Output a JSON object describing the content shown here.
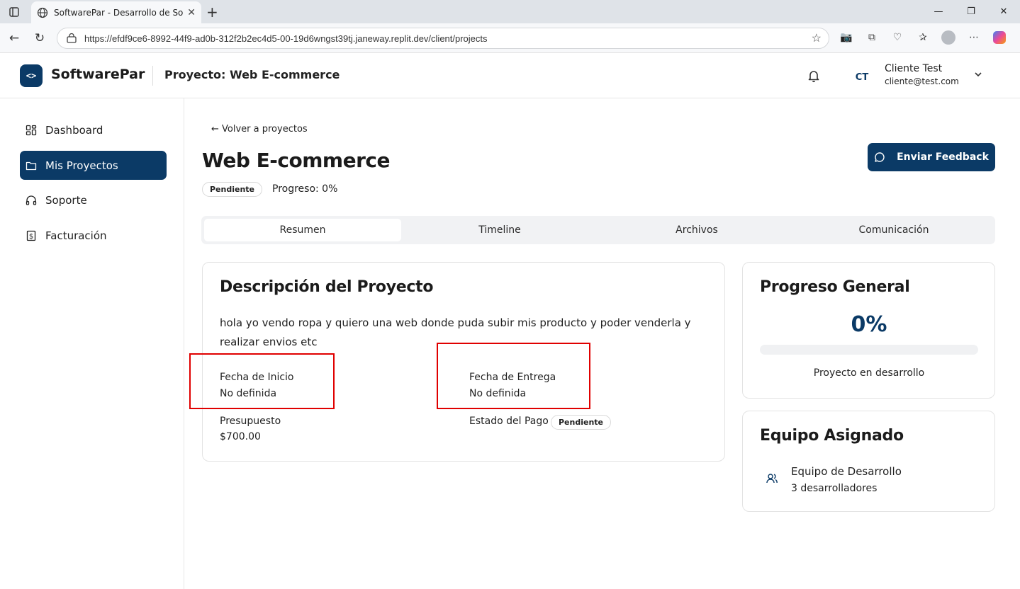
{
  "browser": {
    "tab_title": "SoftwarePar - Desarrollo de Softw",
    "url": "https://efdf9ce6-8992-44f9-ad0b-312f2b2ec4d5-00-19d6wngst39tj.janeway.replit.dev/client/projects"
  },
  "header": {
    "logo_glyph": "<>",
    "brand": "SoftwarePar",
    "project_title": "Proyecto: Web E-commerce",
    "user_initials": "CT",
    "user_name": "Cliente Test",
    "user_email": "cliente@test.com"
  },
  "sidebar": {
    "items": [
      {
        "label": "Dashboard",
        "icon": "grid-icon"
      },
      {
        "label": "Mis Proyectos",
        "icon": "folder-icon",
        "active": true
      },
      {
        "label": "Soporte",
        "icon": "headphones-icon"
      },
      {
        "label": "Facturación",
        "icon": "receipt-icon"
      }
    ]
  },
  "main": {
    "back_link": "← Volver a proyectos",
    "project_name": "Web E-commerce",
    "status_badge": "Pendiente",
    "progress_text": "Progreso: 0%",
    "feedback_button": "Enviar Feedback",
    "tabs": [
      "Resumen",
      "Timeline",
      "Archivos",
      "Comunicación"
    ],
    "active_tab": "Resumen"
  },
  "description_card": {
    "title": "Descripción del Proyecto",
    "text": "hola yo vendo ropa y quiero una web donde puda subir mis producto y poder venderla y realizar envios etc",
    "start_label": "Fecha de Inicio",
    "start_value": "No definida",
    "delivery_label": "Fecha de Entrega",
    "delivery_value": "No definida",
    "budget_label": "Presupuesto",
    "budget_value": "$700.00",
    "payment_label": "Estado del Pago",
    "payment_badge": "Pendiente"
  },
  "progress_card": {
    "title": "Progreso General",
    "percent_text": "0%",
    "percent_value": 0,
    "status": "Proyecto en desarrollo"
  },
  "team_card": {
    "title": "Equipo Asignado",
    "team_name": "Equipo de Desarrollo",
    "team_count": "3 desarrolladores"
  },
  "colors": {
    "brand": "#0b3a66",
    "highlight_box": "#e00000"
  }
}
